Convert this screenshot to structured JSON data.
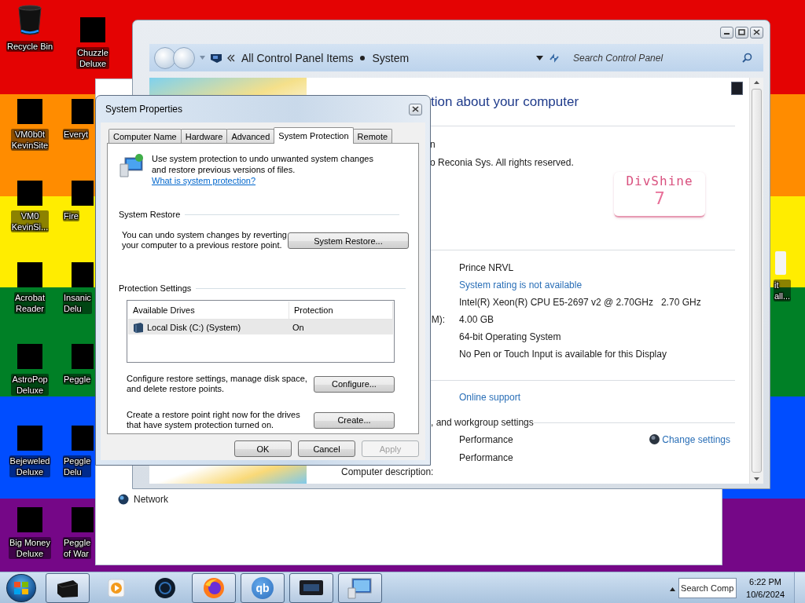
{
  "desktop": {
    "icons": [
      {
        "kind": "bin",
        "lines": [
          "Recycle Bin"
        ]
      },
      {
        "kind": "redacted",
        "lines": [
          "Chuzzle",
          "Deluxe"
        ]
      },
      {
        "kind": "redacted",
        "lines": [
          "VM0b0t",
          "KevinSite"
        ]
      },
      {
        "kind": "redacted",
        "lines": [
          "Everyt"
        ]
      },
      {
        "kind": "redacted",
        "lines": [
          "VM0",
          "KevinSi..."
        ]
      },
      {
        "kind": "redacted",
        "lines": [
          "Fire"
        ]
      },
      {
        "kind": "redacted",
        "lines": [
          "Acrobat",
          "Reader"
        ]
      },
      {
        "kind": "redacted",
        "lines": [
          "Insanic",
          "Delu"
        ]
      },
      {
        "kind": "redacted",
        "lines": [
          "AstroPop",
          "Deluxe"
        ]
      },
      {
        "kind": "redacted",
        "lines": [
          "Peggle"
        ]
      },
      {
        "kind": "redacted",
        "lines": [
          "Bejeweled",
          "Deluxe"
        ]
      },
      {
        "kind": "redacted",
        "lines": [
          "Peggle",
          "Delu"
        ]
      },
      {
        "kind": "redacted",
        "lines": [
          "Big Money",
          "Deluxe"
        ]
      },
      {
        "kind": "redacted",
        "lines": [
          "Peggle",
          "of War"
        ]
      }
    ],
    "edge_icon": {
      "lines": [
        "it",
        "all..."
      ]
    }
  },
  "back_window": {
    "items": [
      {
        "label": "Network"
      }
    ]
  },
  "control_panel": {
    "breadcrumbs": [
      "All Control Panel Items",
      "System"
    ],
    "search": {
      "placeholder": "Search Control Panel"
    },
    "heading": "tion about your computer",
    "copyright_lines": [
      "n",
      "o Reconia Sys.  All rights reserved."
    ],
    "logo": {
      "name": "DivShine",
      "version": "7"
    },
    "system_rows": [
      {
        "kind": "text",
        "value": "Prince NRVL"
      },
      {
        "kind": "link",
        "value": "System rating is not available"
      },
      {
        "kind": "text",
        "value": "Intel(R) Xeon(R) CPU E5-2697 v2 @ 2.70GHz   2.70 GHz"
      },
      {
        "kind": "text",
        "label": "M):",
        "value": "4.00 GB"
      },
      {
        "kind": "text",
        "value": "64-bit Operating System"
      },
      {
        "kind": "text",
        "value": "No Pen or Touch Input is available for this Display"
      }
    ],
    "support_link": "Online support",
    "settings_section": {
      "heading": ", and workgroup settings",
      "rows": [
        {
          "value": "Performance",
          "action": "Change settings"
        },
        {
          "value": "Performance"
        }
      ],
      "description_label": "Computer description:"
    }
  },
  "system_properties": {
    "title": "System Properties",
    "tabs": [
      {
        "label": "Computer Name",
        "selected": false
      },
      {
        "label": "Hardware",
        "selected": false
      },
      {
        "label": "Advanced",
        "selected": false
      },
      {
        "label": "System Protection",
        "selected": true
      },
      {
        "label": "Remote",
        "selected": false
      }
    ],
    "intro": "Use system protection to undo unwanted system changes and restore previous versions of files.",
    "intro_link": "What is system protection?",
    "system_restore": {
      "heading": "System Restore",
      "text": "You can undo system changes by reverting your computer to a previous restore point.",
      "button": "System Restore..."
    },
    "protection_settings": {
      "heading": "Protection Settings",
      "columns": [
        "Available Drives",
        "Protection"
      ],
      "rows": [
        {
          "drive": "Local Disk (C:) (System)",
          "protection": "On",
          "selected": true
        }
      ],
      "actions": [
        {
          "text": "Configure restore settings, manage disk space, and delete restore points.",
          "button": "Configure..."
        },
        {
          "text": "Create a restore point right now for the drives that have system protection turned on.",
          "button": "Create..."
        }
      ]
    },
    "buttons": [
      {
        "label": "OK",
        "disabled": false
      },
      {
        "label": "Cancel",
        "disabled": false
      },
      {
        "label": "Apply",
        "disabled": true
      }
    ]
  },
  "taskbar": {
    "apps": [
      {
        "kind": "box",
        "running": true
      },
      {
        "kind": "media",
        "running": false
      },
      {
        "kind": "sphere",
        "running": false
      },
      {
        "kind": "firefox",
        "running": true
      },
      {
        "kind": "qb",
        "label": "qb",
        "running": true
      },
      {
        "kind": "monitor",
        "running": true
      },
      {
        "kind": "computer",
        "running": true
      }
    ],
    "tray": {
      "search_text": "Search Comp",
      "time": "6:22 PM",
      "date": "10/6/2024"
    }
  }
}
